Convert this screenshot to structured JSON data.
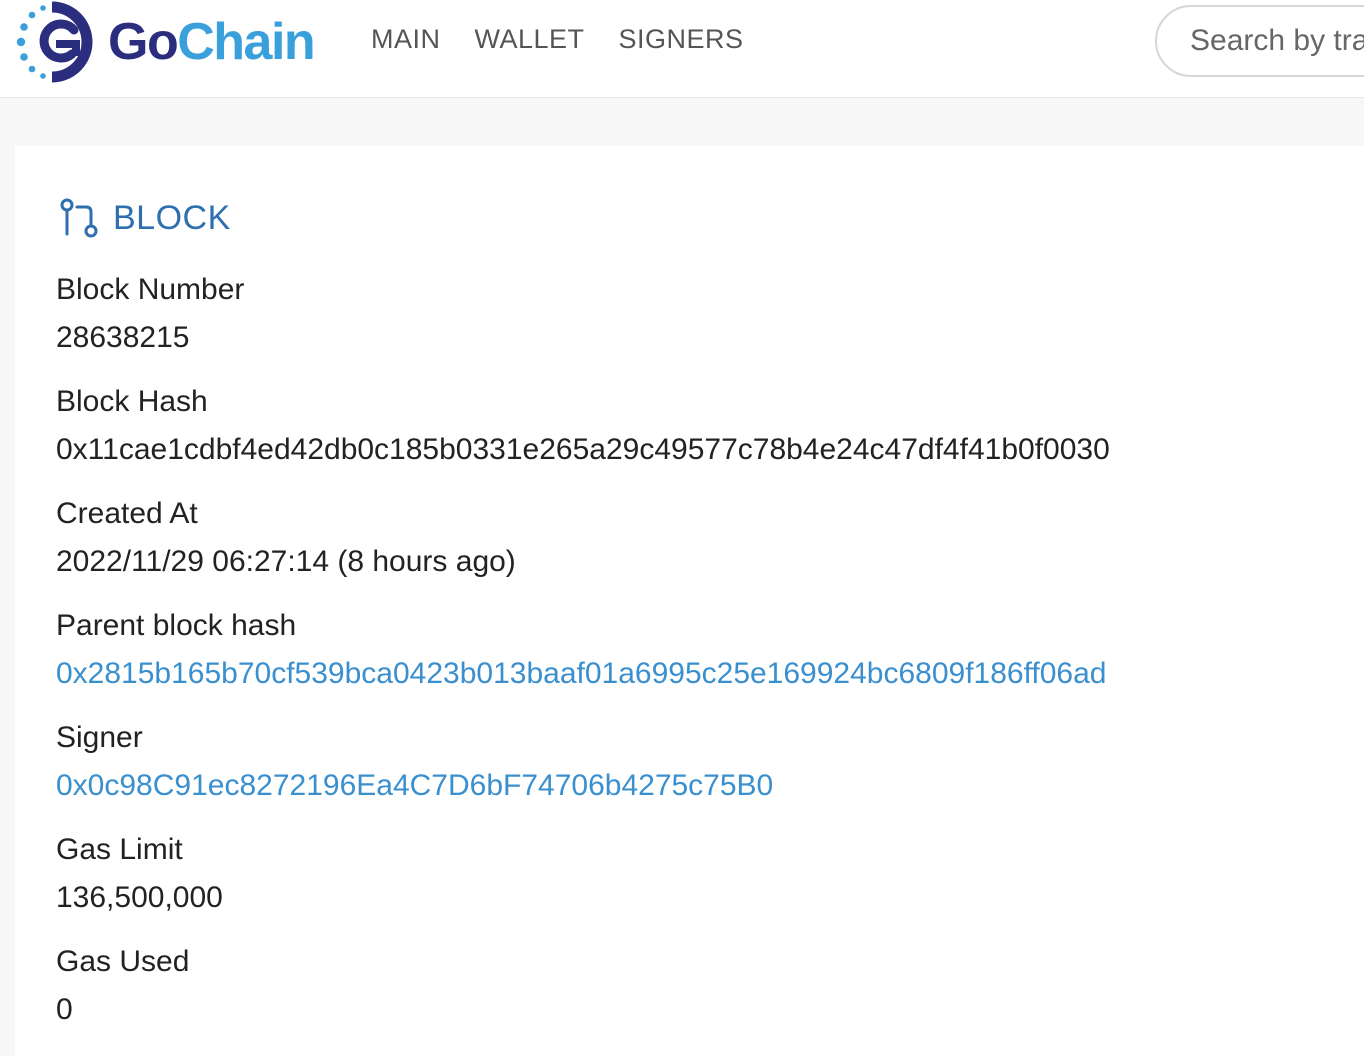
{
  "brand": {
    "name_part1": "Go",
    "name_part2": "Chain",
    "logo_icon": "gochain-logo-icon",
    "colors": {
      "primary": "#2b2d7e",
      "accent": "#3aa0dc"
    }
  },
  "nav": {
    "items": [
      {
        "label": "MAIN"
      },
      {
        "label": "WALLET"
      },
      {
        "label": "SIGNERS"
      }
    ]
  },
  "search": {
    "placeholder": "Search by transaction hash, block number or address"
  },
  "card": {
    "title": "BLOCK",
    "title_icon": "git-compare-icon",
    "title_color": "#2f6fb0",
    "link_color": "#3a8fcf"
  },
  "fields": [
    {
      "label": "Block Number",
      "value": "28638215",
      "is_link": false
    },
    {
      "label": "Block Hash",
      "value": "0x11cae1cdbf4ed42db0c185b0331e265a29c49577c78b4e24c47df4f41b0f0030",
      "is_link": false
    },
    {
      "label": "Created At",
      "value": "2022/11/29 06:27:14 (8 hours ago)",
      "is_link": false
    },
    {
      "label": "Parent block hash",
      "value": "0x2815b165b70cf539bca0423b013baaf01a6995c25e169924bc6809f186ff06ad",
      "is_link": true
    },
    {
      "label": "Signer",
      "value": "0x0c98C91ec8272196Ea4C7D6bF74706b4275c75B0",
      "is_link": true
    },
    {
      "label": "Gas Limit",
      "value": "136,500,000",
      "is_link": false
    },
    {
      "label": "Gas Used",
      "value": "0",
      "is_link": false
    }
  ]
}
